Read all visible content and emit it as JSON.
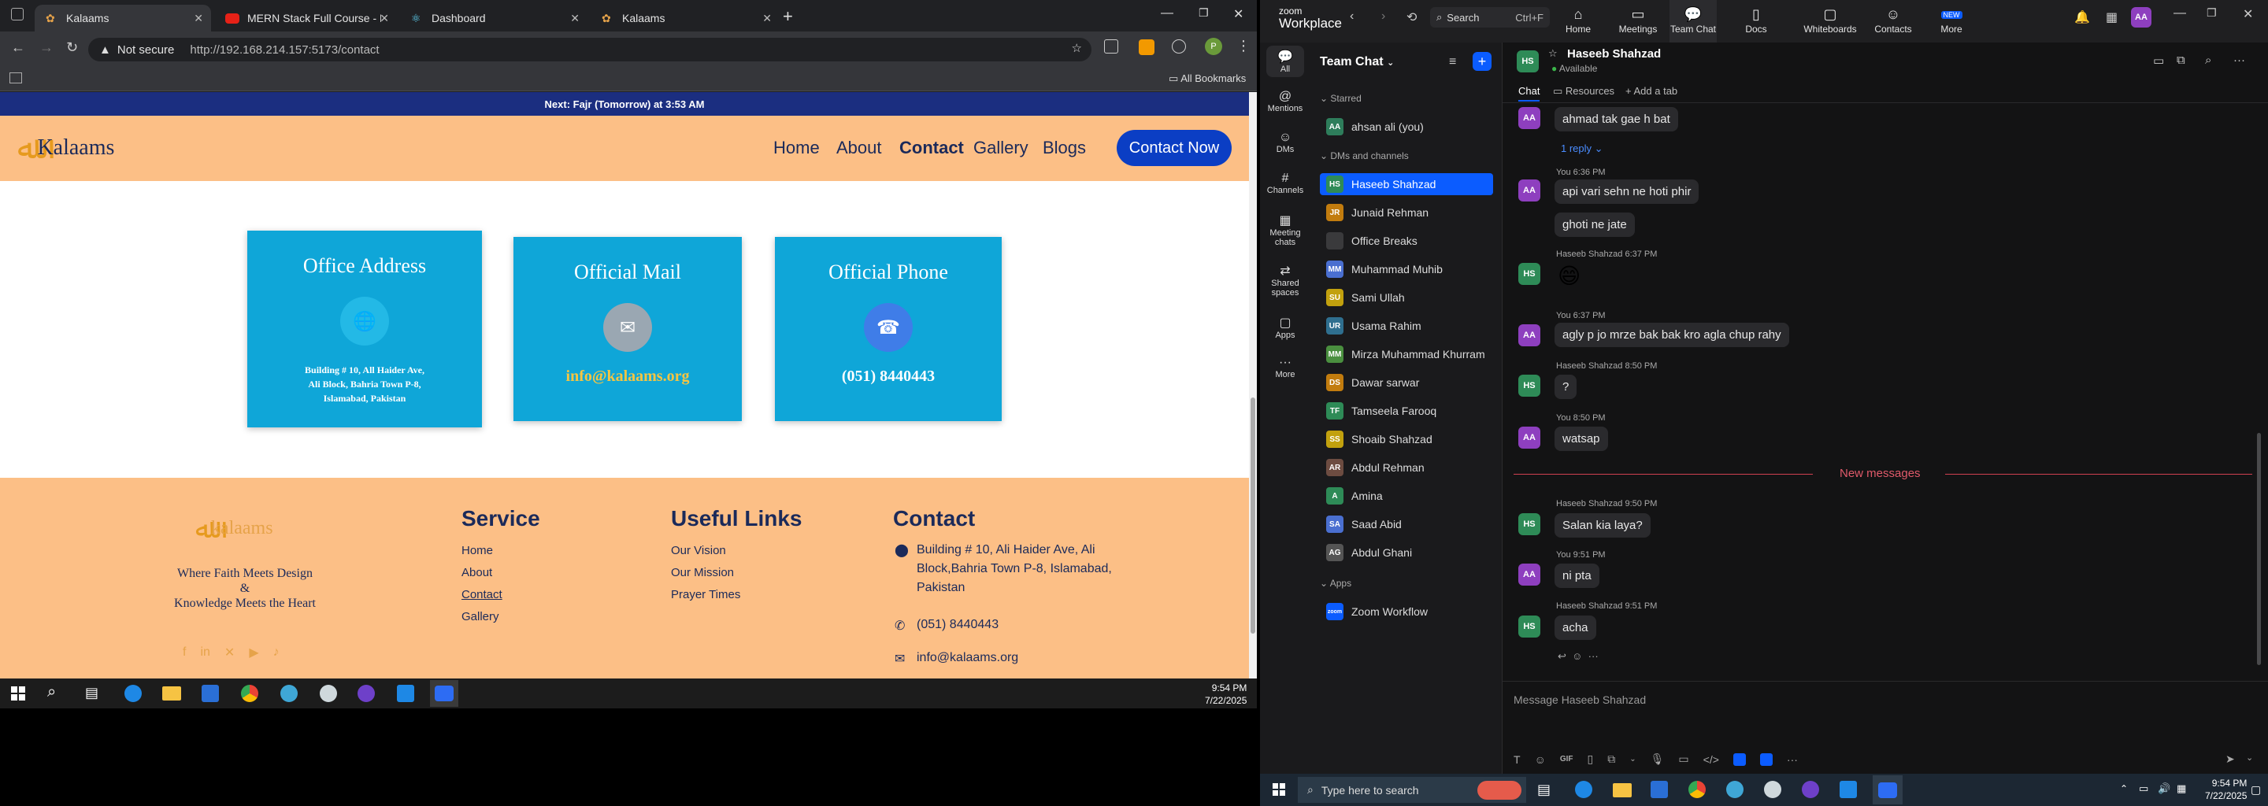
{
  "browser": {
    "tabs": [
      {
        "label": "Kalaams",
        "active": true
      },
      {
        "label": "MERN Stack Full Course - ECom",
        "active": false
      },
      {
        "label": "Dashboard",
        "active": false
      },
      {
        "label": "Kalaams",
        "active": false
      }
    ],
    "url_security": "Not secure",
    "url": "http://192.168.214.157:5173/contact",
    "bookmarks_label": "All Bookmarks",
    "profile_initial": "P"
  },
  "site": {
    "prayer_bar": "Next: Fajr (Tomorrow) at 3:53 AM",
    "logo_text": "Kalaams",
    "nav": [
      "Home",
      "About",
      "Contact",
      "Gallery",
      "Blogs"
    ],
    "cta": "Contact Now",
    "cards": {
      "address": {
        "title": "Office Address",
        "line1": "Building # 10, All Haider Ave,",
        "line2": "Ali Block, Bahria Town P-8,",
        "line3": "Islamabad, Pakistan"
      },
      "mail": {
        "title": "Official Mail",
        "value": "info@kalaams.org"
      },
      "phone": {
        "title": "Official Phone",
        "value": "(051) 8440443"
      }
    },
    "footer": {
      "logo_text": "kalaams",
      "tagline1": "Where Faith Meets Design",
      "tagline2": "&",
      "tagline3": "Knowledge Meets the Heart",
      "service_title": "Service",
      "service_links": [
        "Home",
        "About",
        "Contact",
        "Gallery"
      ],
      "useful_title": "Useful Links",
      "useful_links": [
        "Our Vision",
        "Our Mission",
        "Prayer Times"
      ],
      "contact_title": "Contact",
      "contact_address1": "Building # 10, Ali Haider Ave, Ali",
      "contact_address2": "Block,Bahria Town P-8, Islamabad,",
      "contact_address3": "Pakistan",
      "contact_phone": "(051) 8440443",
      "contact_email": "info@kalaams.org"
    }
  },
  "taskbar_left": {
    "time": "9:54 PM",
    "date": "7/22/2025"
  },
  "zoom": {
    "brand_top": "zoom",
    "brand_bottom": "Workplace",
    "search": "Search",
    "search_shortcut": "Ctrl+F",
    "top_nav": [
      "Home",
      "Meetings",
      "Team Chat",
      "Docs",
      "Whiteboards",
      "Contacts",
      "More"
    ],
    "new_badge": "NEW",
    "user_initials": "AA",
    "rail": [
      "All",
      "Mentions",
      "DMs",
      "Channels",
      "Meeting chats",
      "Shared spaces",
      "Apps",
      "More"
    ],
    "list_title": "Team Chat",
    "starred_label": "Starred",
    "starred": [
      {
        "initials": "AA",
        "name": "ahsan ali (you)",
        "color": "#2e7d5b"
      }
    ],
    "dms_label": "DMs and channels",
    "dms": [
      {
        "initials": "HS",
        "name": "Haseeb Shahzad",
        "color": "#2e8b57",
        "selected": true
      },
      {
        "initials": "JR",
        "name": "Junaid Rehman",
        "color": "#c27c0e"
      },
      {
        "initials": "",
        "name": "Office Breaks",
        "color": "#3a3a3c"
      },
      {
        "initials": "MM",
        "name": "Muhammad Muhib",
        "color": "#4a6fd0"
      },
      {
        "initials": "SU",
        "name": "Sami Ullah",
        "color": "#c2a10e"
      },
      {
        "initials": "UR",
        "name": "Usama Rahim",
        "color": "#2f6f8f"
      },
      {
        "initials": "MM",
        "name": "Mirza Muhammad Khurram",
        "color": "#4a8f3f"
      },
      {
        "initials": "DS",
        "name": "Dawar sarwar",
        "color": "#c27c0e"
      },
      {
        "initials": "TF",
        "name": "Tamseela Farooq",
        "color": "#2e8b57"
      },
      {
        "initials": "SS",
        "name": "Shoaib Shahzad",
        "color": "#c2a10e"
      },
      {
        "initials": "AR",
        "name": "Abdul Rehman",
        "color": "#6d4c41"
      },
      {
        "initials": "A",
        "name": "Amina",
        "color": "#2e8b57"
      },
      {
        "initials": "SA",
        "name": "Saad Abid",
        "color": "#4a6fd0"
      },
      {
        "initials": "AG",
        "name": "Abdul Ghani",
        "color": "#555"
      }
    ],
    "apps_label": "Apps",
    "apps": [
      {
        "initials": "zoom",
        "name": "Zoom Workflow",
        "color": "#0b5cff"
      }
    ],
    "chat": {
      "contact": "Haseeb Shahzad",
      "status": "Available",
      "tabs": [
        "Chat",
        "Resources",
        "Add a tab"
      ],
      "messages": [
        {
          "av": "AA",
          "meta": "",
          "text": "ahmad tak gae h bat"
        },
        {
          "av": "",
          "meta": "",
          "text": "1 reply"
        },
        {
          "av": "AA",
          "meta": "You 6:36 PM",
          "text": "api vari sehn ne hoti phir"
        },
        {
          "av": "",
          "meta": "",
          "text": "ghoti ne jate"
        },
        {
          "av": "HS",
          "meta": "Haseeb Shahzad 6:37 PM",
          "text": "😄"
        },
        {
          "av": "AA",
          "meta": "You 6:37 PM",
          "text": "agly p jo mrze bak bak kro agla chup rahy"
        },
        {
          "av": "HS",
          "meta": "Haseeb Shahzad 8:50 PM",
          "text": "?"
        },
        {
          "av": "AA",
          "meta": "You 8:50 PM",
          "text": "watsap"
        },
        {
          "av": "HS",
          "meta": "Haseeb Shahzad 9:50 PM",
          "text": "Salan kia laya?"
        },
        {
          "av": "AA",
          "meta": "You 9:51 PM",
          "text": "ni pta"
        },
        {
          "av": "HS",
          "meta": "Haseeb Shahzad 9:51 PM",
          "text": "acha"
        }
      ],
      "new_messages_label": "New messages",
      "input_placeholder": "Message Haseeb Shahzad"
    }
  },
  "taskbar_right": {
    "search": "Type here to search",
    "time": "9:54 PM",
    "date": "7/22/2025"
  }
}
